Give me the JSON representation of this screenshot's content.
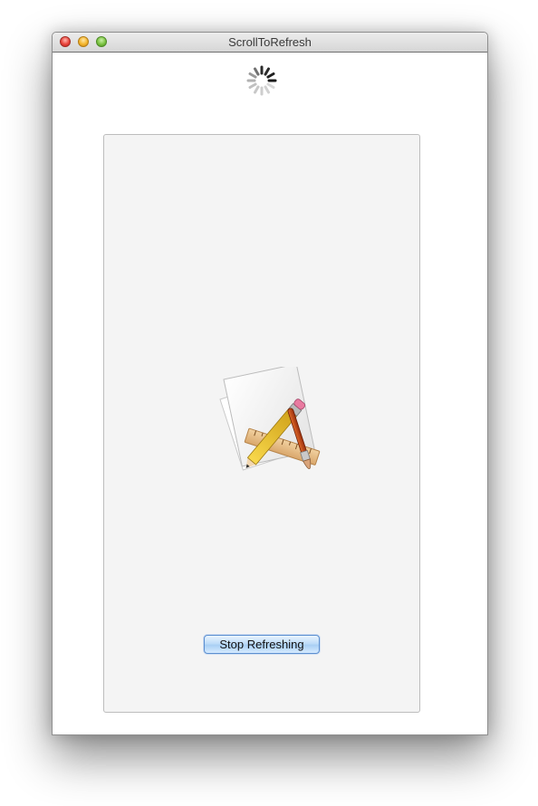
{
  "window": {
    "title": "ScrollToRefresh"
  },
  "titlebar_buttons": {
    "close": "close-icon",
    "minimize": "minimize-icon",
    "zoom": "zoom-icon"
  },
  "refresh_indicator": {
    "icon": "activity-spinner-icon"
  },
  "content": {
    "icon": "xcode-app-icon",
    "stop_button_label": "Stop Refreshing"
  },
  "colors": {
    "accent": "#5c8fd0",
    "content_background": "#f4f4f4"
  }
}
